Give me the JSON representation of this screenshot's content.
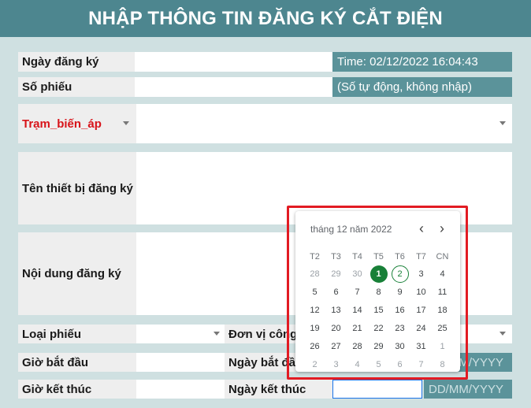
{
  "title": "NHẬP THÔNG TIN ĐĂNG KÝ CẮT ĐIỆN",
  "form": {
    "ngay_dang_ky_label": "Ngày đăng ký",
    "ngay_dang_ky_value": "Time: 02/12/2022 16:04:43",
    "so_phieu_label": "Số phiếu",
    "so_phieu_value": "(Số tự động, không nhập)",
    "tram_bien_ap_label": "Trạm_biến_áp",
    "ten_thiet_bi_label": "Tên thiết bị đăng ký",
    "noi_dung_label": "Nội dung đăng ký",
    "loai_phieu_label": "Loại phiếu",
    "don_vi_label": "Đơn vị công",
    "gio_bat_dau_label": "Giờ bắt đầu",
    "ngay_bat_dau_label": "Ngày bắt đầu",
    "ngay_bat_dau_placeholder": "DD/MM/YYYY",
    "gio_ket_thuc_label": "Giờ kết thúc",
    "ngay_ket_thuc_label": "Ngày kết thúc",
    "ngay_ket_thuc_placeholder": "DD/MM/YYYY"
  },
  "calendar": {
    "month_label": "tháng 12 năm 2022",
    "prev": "‹",
    "next": "›",
    "weekdays": [
      "T2",
      "T3",
      "T4",
      "T5",
      "T6",
      "T7",
      "CN"
    ],
    "weeks": [
      [
        "28",
        "29",
        "30",
        "1",
        "2",
        "3",
        "4"
      ],
      [
        "5",
        "6",
        "7",
        "8",
        "9",
        "10",
        "11"
      ],
      [
        "12",
        "13",
        "14",
        "15",
        "16",
        "17",
        "18"
      ],
      [
        "19",
        "20",
        "21",
        "22",
        "23",
        "24",
        "25"
      ],
      [
        "26",
        "27",
        "28",
        "29",
        "30",
        "31",
        "1"
      ],
      [
        "2",
        "3",
        "4",
        "5",
        "6",
        "7",
        "8"
      ]
    ],
    "selected_day": "1",
    "today_day": "2",
    "colors": {
      "selected": "#188038",
      "highlight_border": "#e21b23"
    }
  },
  "colors": {
    "header": "#4d868f",
    "value_cell": "#5b939a",
    "background": "#cfe0e1",
    "required_label": "#d8141a"
  }
}
